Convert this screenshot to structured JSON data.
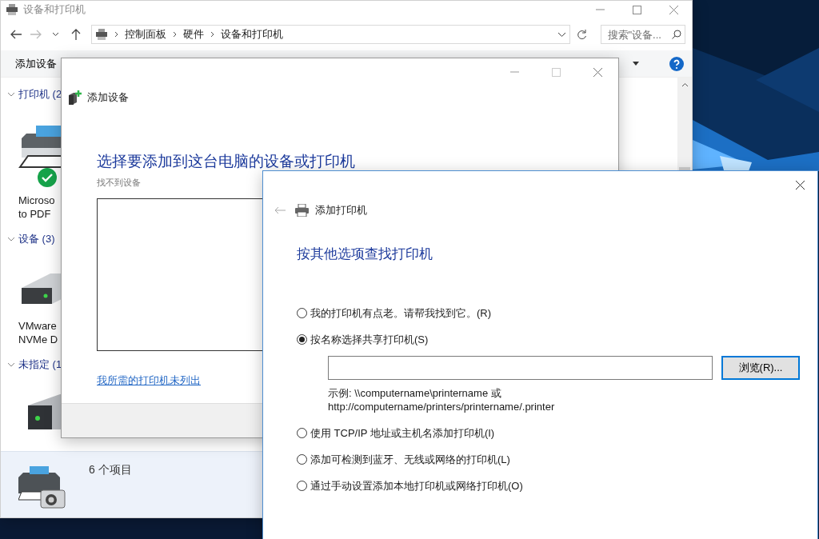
{
  "explorer": {
    "title": "设备和打印机",
    "breadcrumb": [
      "控制面板",
      "硬件",
      "设备和打印机"
    ],
    "search": {
      "placeholder": "搜索\"设备..."
    },
    "toolbar": [
      "添加设备"
    ],
    "groups": [
      {
        "label": "打印机 (2",
        "expanded": true,
        "items": [
          {
            "kind": "printer",
            "lines": [
              "Microso",
              "to PDF"
            ],
            "default": true
          }
        ]
      },
      {
        "label": "设备 (3)",
        "expanded": true,
        "items": [
          {
            "kind": "drive",
            "lines": [
              "VMware",
              "NVMe D"
            ]
          }
        ]
      },
      {
        "label": "未指定 (1",
        "expanded": true,
        "items": [
          {
            "kind": "tower"
          }
        ]
      }
    ],
    "status": "6 个项目"
  },
  "add_device_dialog": {
    "header": "添加设备",
    "heading": "选择要添加到这台电脑的设备或打印机",
    "message": "找不到设备",
    "link": "我所需的打印机未列出"
  },
  "add_printer_dialog": {
    "header": "添加打印机",
    "heading": "按其他选项查找打印机",
    "options": [
      {
        "label": "我的打印机有点老。请帮我找到它。(R)",
        "selected": false
      },
      {
        "label": "按名称选择共享打印机(S)",
        "selected": true,
        "name_field": {
          "button": "浏览(R)...",
          "example": [
            "示例: \\\\computername\\printername 或",
            "http://computername/printers/printername/.printer"
          ]
        }
      },
      {
        "label": "使用 TCP/IP 地址或主机名添加打印机(I)",
        "selected": false
      },
      {
        "label": "添加可检测到蓝牙、无线或网络的打印机(L)",
        "selected": false
      },
      {
        "label": "通过手动设置添加本地打印机或网络打印机(O)",
        "selected": false
      }
    ]
  }
}
